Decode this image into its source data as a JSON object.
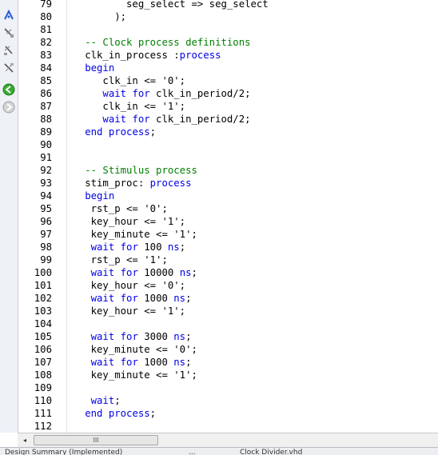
{
  "editor": {
    "lines": [
      {
        "n": "79",
        "t": [
          {
            "s": "          seg_select => seg_select",
            "c": ""
          }
        ]
      },
      {
        "n": "80",
        "t": [
          {
            "s": "        );",
            "c": ""
          }
        ]
      },
      {
        "n": "81",
        "t": []
      },
      {
        "n": "82",
        "t": [
          {
            "s": "   -- Clock process definitions",
            "c": "cm"
          }
        ]
      },
      {
        "n": "83",
        "t": [
          {
            "s": "   clk_in_process :",
            "c": ""
          },
          {
            "s": "process",
            "c": "kw"
          }
        ]
      },
      {
        "n": "84",
        "t": [
          {
            "s": "   ",
            "c": ""
          },
          {
            "s": "begin",
            "c": "kw"
          }
        ]
      },
      {
        "n": "85",
        "t": [
          {
            "s": "      clk_in <= '0';",
            "c": ""
          }
        ]
      },
      {
        "n": "86",
        "t": [
          {
            "s": "      ",
            "c": ""
          },
          {
            "s": "wait for",
            "c": "kw"
          },
          {
            "s": " clk_in_period/2;",
            "c": ""
          }
        ]
      },
      {
        "n": "87",
        "t": [
          {
            "s": "      clk_in <= '1';",
            "c": ""
          }
        ]
      },
      {
        "n": "88",
        "t": [
          {
            "s": "      ",
            "c": ""
          },
          {
            "s": "wait for",
            "c": "kw"
          },
          {
            "s": " clk_in_period/2;",
            "c": ""
          }
        ]
      },
      {
        "n": "89",
        "t": [
          {
            "s": "   ",
            "c": ""
          },
          {
            "s": "end process",
            "c": "kw"
          },
          {
            "s": ";",
            "c": ""
          }
        ]
      },
      {
        "n": "90",
        "t": []
      },
      {
        "n": "91",
        "t": []
      },
      {
        "n": "92",
        "t": [
          {
            "s": "   -- Stimulus process",
            "c": "cm"
          }
        ]
      },
      {
        "n": "93",
        "t": [
          {
            "s": "   stim_proc: ",
            "c": ""
          },
          {
            "s": "process",
            "c": "kw"
          }
        ]
      },
      {
        "n": "94",
        "t": [
          {
            "s": "   ",
            "c": ""
          },
          {
            "s": "begin",
            "c": "kw"
          }
        ]
      },
      {
        "n": "95",
        "t": [
          {
            "s": "    rst_p <= '0';",
            "c": ""
          }
        ]
      },
      {
        "n": "96",
        "t": [
          {
            "s": "    key_hour <= '1';",
            "c": ""
          }
        ]
      },
      {
        "n": "97",
        "t": [
          {
            "s": "    key_minute <= '1';",
            "c": ""
          }
        ]
      },
      {
        "n": "98",
        "t": [
          {
            "s": "    ",
            "c": ""
          },
          {
            "s": "wait for",
            "c": "kw"
          },
          {
            "s": " 100 ",
            "c": ""
          },
          {
            "s": "ns",
            "c": "kw"
          },
          {
            "s": ";",
            "c": ""
          }
        ]
      },
      {
        "n": "99",
        "t": [
          {
            "s": "    rst_p <= '1';",
            "c": ""
          }
        ]
      },
      {
        "n": "100",
        "t": [
          {
            "s": "    ",
            "c": ""
          },
          {
            "s": "wait for",
            "c": "kw"
          },
          {
            "s": " 10000 ",
            "c": ""
          },
          {
            "s": "ns",
            "c": "kw"
          },
          {
            "s": ";",
            "c": ""
          }
        ]
      },
      {
        "n": "101",
        "t": [
          {
            "s": "    key_hour <= '0';",
            "c": ""
          }
        ]
      },
      {
        "n": "102",
        "t": [
          {
            "s": "    ",
            "c": ""
          },
          {
            "s": "wait for",
            "c": "kw"
          },
          {
            "s": " 1000 ",
            "c": ""
          },
          {
            "s": "ns",
            "c": "kw"
          },
          {
            "s": ";",
            "c": ""
          }
        ]
      },
      {
        "n": "103",
        "t": [
          {
            "s": "    key_hour <= '1';",
            "c": ""
          }
        ]
      },
      {
        "n": "104",
        "t": []
      },
      {
        "n": "105",
        "t": [
          {
            "s": "    ",
            "c": ""
          },
          {
            "s": "wait for",
            "c": "kw"
          },
          {
            "s": " 3000 ",
            "c": ""
          },
          {
            "s": "ns",
            "c": "kw"
          },
          {
            "s": ";",
            "c": ""
          }
        ]
      },
      {
        "n": "106",
        "t": [
          {
            "s": "    key_minute <= '0';",
            "c": ""
          }
        ]
      },
      {
        "n": "107",
        "t": [
          {
            "s": "    ",
            "c": ""
          },
          {
            "s": "wait for",
            "c": "kw"
          },
          {
            "s": " 1000 ",
            "c": ""
          },
          {
            "s": "ns",
            "c": "kw"
          },
          {
            "s": ";",
            "c": ""
          }
        ]
      },
      {
        "n": "108",
        "t": [
          {
            "s": "    key_minute <= '1';",
            "c": ""
          }
        ]
      },
      {
        "n": "109",
        "t": []
      },
      {
        "n": "110",
        "t": [
          {
            "s": "    ",
            "c": ""
          },
          {
            "s": "wait",
            "c": "kw"
          },
          {
            "s": ";",
            "c": ""
          }
        ]
      },
      {
        "n": "111",
        "t": [
          {
            "s": "   ",
            "c": ""
          },
          {
            "s": "end process",
            "c": "kw"
          },
          {
            "s": ";",
            "c": ""
          }
        ]
      },
      {
        "n": "112",
        "t": []
      }
    ]
  },
  "toolbar": {
    "icons": [
      "pin-icon",
      "indent-icon",
      "outdent-icon",
      "comment-icon",
      "go-back-icon",
      "go-forward-icon"
    ]
  },
  "scrollbar": {
    "left_arrow": "◂",
    "thumb_grip": "III"
  },
  "statusbar": {
    "items": [
      "Design Summary (Implemented)",
      "...",
      "Clock Divider.vhd"
    ]
  },
  "colors": {
    "keyword": "#0000e6",
    "comment": "#008000",
    "text": "#000000"
  }
}
